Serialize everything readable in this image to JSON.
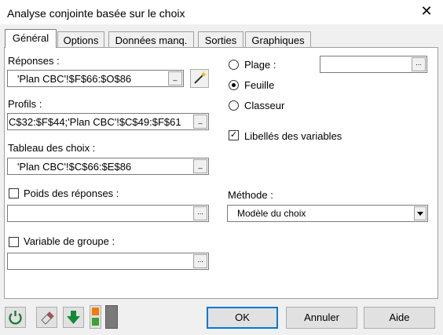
{
  "window": {
    "title": "Analyse conjointe basée sur le choix"
  },
  "tabs": [
    "Général",
    "Options",
    "Données manq.",
    "Sorties",
    "Graphiques"
  ],
  "general": {
    "responses": {
      "label": "Réponses :",
      "value": "'Plan CBC'!$F$66:$O$86"
    },
    "profiles": {
      "label": "Profils :",
      "value": "C$32:$F$44;'Plan CBC'!$C$49:$F$61"
    },
    "choice_table": {
      "label": "Tableau des choix :",
      "value": "'Plan CBC'!$C$66:$E$86"
    },
    "weights": {
      "label": "Poids des réponses :",
      "checked": false,
      "value": ""
    },
    "group_variable": {
      "label": "Variable de groupe :",
      "checked": false,
      "value": ""
    },
    "output": {
      "range_label": "Plage :",
      "sheet_label": "Feuille",
      "workbook_label": "Classeur",
      "selected": "Feuille",
      "range_value": ""
    },
    "variable_labels": {
      "label": "Libellés des variables",
      "checked": true
    },
    "method": {
      "label": "Méthode :",
      "value": "Modèle du choix"
    }
  },
  "buttons": {
    "ok": "OK",
    "cancel": "Annuler",
    "help": "Aide"
  },
  "colors": {
    "accent": "#0078d7",
    "reset_icon": "#1f7a3a",
    "down_arrow": "#138a36",
    "orange": "#f07c00",
    "green": "#3aa335"
  }
}
